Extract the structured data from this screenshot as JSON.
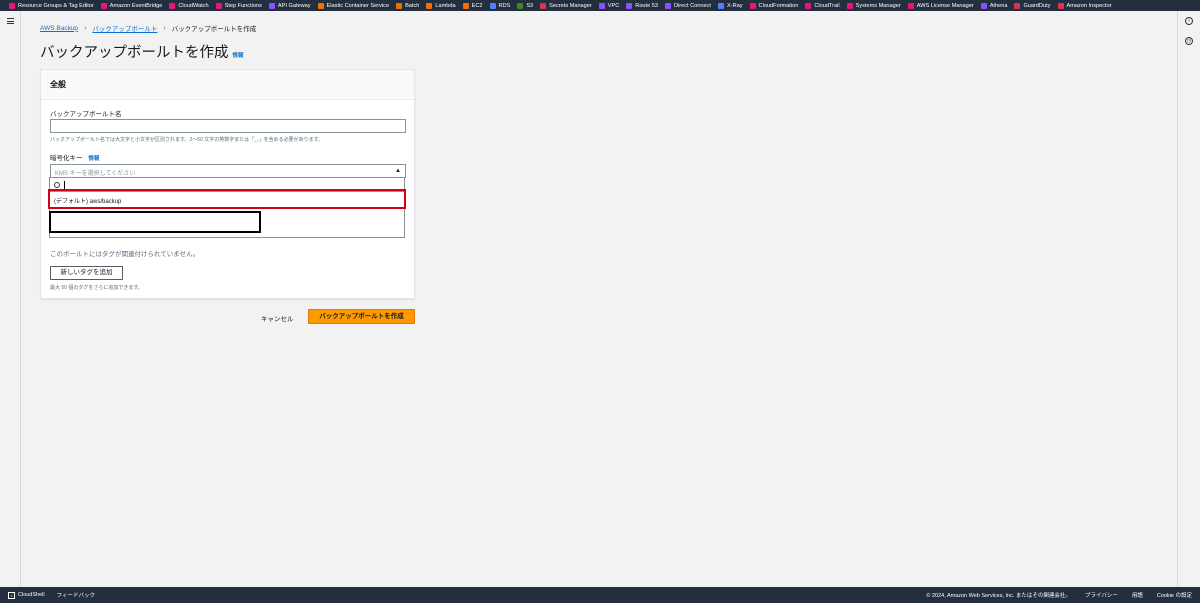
{
  "favorites": [
    {
      "label": "Resource Groups & Tag Editor",
      "color": "#e7157b"
    },
    {
      "label": "Amazon EventBridge",
      "color": "#e7157b"
    },
    {
      "label": "CloudWatch",
      "color": "#e7157b"
    },
    {
      "label": "Step Functions",
      "color": "#e7157b"
    },
    {
      "label": "API Gateway",
      "color": "#8c4fff"
    },
    {
      "label": "Elastic Container Service",
      "color": "#ed7100"
    },
    {
      "label": "Batch",
      "color": "#ed7100"
    },
    {
      "label": "Lambda",
      "color": "#ed7100"
    },
    {
      "label": "EC2",
      "color": "#ed7100"
    },
    {
      "label": "RDS",
      "color": "#527fff"
    },
    {
      "label": "S3",
      "color": "#3f8624"
    },
    {
      "label": "Secrets Manager",
      "color": "#dd344c"
    },
    {
      "label": "VPC",
      "color": "#8c4fff"
    },
    {
      "label": "Route 53",
      "color": "#8c4fff"
    },
    {
      "label": "Direct Connect",
      "color": "#8c4fff"
    },
    {
      "label": "X-Ray",
      "color": "#527fff"
    },
    {
      "label": "CloudFormation",
      "color": "#e7157b"
    },
    {
      "label": "CloudTrail",
      "color": "#e7157b"
    },
    {
      "label": "Systems Manager",
      "color": "#e7157b"
    },
    {
      "label": "AWS License Manager",
      "color": "#e7157b"
    },
    {
      "label": "Athena",
      "color": "#8c4fff"
    },
    {
      "label": "GuardDuty",
      "color": "#dd344c"
    },
    {
      "label": "Amazon Inspector",
      "color": "#dd344c"
    }
  ],
  "breadcrumb": {
    "items": [
      "AWS Backup",
      "バックアップボールト",
      "バックアップボールトを作成"
    ]
  },
  "page": {
    "title": "バックアップボールトを作成",
    "info": "情報"
  },
  "general": {
    "header": "全般",
    "vault_name_label": "バックアップボールト名",
    "vault_name_value": "",
    "vault_name_hint": "バックアップボールト名では大文字と小文字が区別されます。2〜50 文字の英数字または「_-」を含める必要があります。",
    "encryption_label": "暗号化キー",
    "encryption_info": "情報",
    "encryption_placeholder": "KMS キーを選択してください",
    "search_value": "",
    "option_default": "(デフォルト) aws/backup"
  },
  "tags": {
    "empty_text": "このボールトにはタグが関連付けられていません。",
    "add_button": "新しいタグを追加",
    "limit_text": "最大 50 個のタグをさらに追加できます。"
  },
  "actions": {
    "cancel": "キャンセル",
    "create": "バックアップボールトを作成"
  },
  "footer": {
    "cloudshell": "CloudShell",
    "feedback": "フィードバック",
    "copyright": "© 2024, Amazon Web Services, Inc. またはその関連会社。",
    "privacy": "プライバシー",
    "terms": "用語",
    "cookies": "Cookie の設定"
  }
}
